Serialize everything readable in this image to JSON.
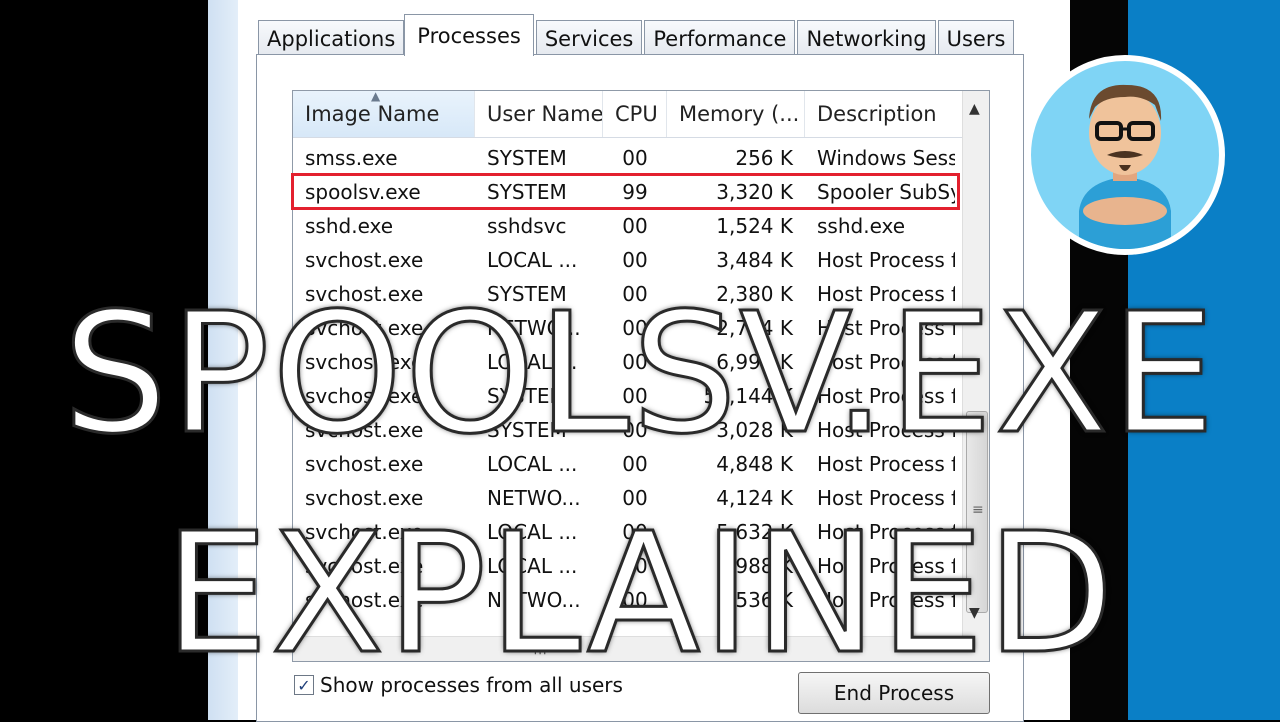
{
  "tabs": [
    "Applications",
    "Processes",
    "Services",
    "Performance",
    "Networking",
    "Users"
  ],
  "active_tab": "Processes",
  "columns": [
    "Image Name",
    "User Name",
    "CPU",
    "Memory (...",
    "Description"
  ],
  "rows": [
    {
      "name": "smss.exe",
      "user": "SYSTEM",
      "cpu": "00",
      "mem": "256 K",
      "desc": "Windows Sess"
    },
    {
      "name": "spoolsv.exe",
      "user": "SYSTEM",
      "cpu": "99",
      "mem": "3,320 K",
      "desc": "Spooler SubSy"
    },
    {
      "name": "sshd.exe",
      "user": "sshdsvc",
      "cpu": "00",
      "mem": "1,524 K",
      "desc": "sshd.exe"
    },
    {
      "name": "svchost.exe",
      "user": "LOCAL ...",
      "cpu": "00",
      "mem": "3,484 K",
      "desc": "Host Process f"
    },
    {
      "name": "svchost.exe",
      "user": "SYSTEM",
      "cpu": "00",
      "mem": "2,380 K",
      "desc": "Host Process f"
    },
    {
      "name": "svchost.exe",
      "user": "NETWO...",
      "cpu": "00",
      "mem": "2,764 K",
      "desc": "Host Process f"
    },
    {
      "name": "svchost.exe",
      "user": "LOCAL ...",
      "cpu": "00",
      "mem": "6,992 K",
      "desc": "Host Process f"
    },
    {
      "name": "svchost.exe",
      "user": "SYSTEM",
      "cpu": "00",
      "mem": "50,144 K",
      "desc": "Host Process f"
    },
    {
      "name": "svchost.exe",
      "user": "SYSTEM",
      "cpu": "00",
      "mem": "3,028 K",
      "desc": "Host Process f"
    },
    {
      "name": "svchost.exe",
      "user": "LOCAL ...",
      "cpu": "00",
      "mem": "4,848 K",
      "desc": "Host Process f"
    },
    {
      "name": "svchost.exe",
      "user": "NETWO...",
      "cpu": "00",
      "mem": "4,124 K",
      "desc": "Host Process f"
    },
    {
      "name": "svchost.exe",
      "user": "LOCAL ...",
      "cpu": "00",
      "mem": "5,632 K",
      "desc": "Host Process f"
    },
    {
      "name": "svchost.exe",
      "user": "LOCAL ...",
      "cpu": "00",
      "mem": "988 K",
      "desc": "Host Process f"
    },
    {
      "name": "svchost.exe",
      "user": "NETWO...",
      "cpu": "00",
      "mem": "1,536 K",
      "desc": "Host Process f"
    }
  ],
  "highlighted_row": 1,
  "checkbox": {
    "label": "Show processes from all users",
    "checked": true
  },
  "end_button": "End Process",
  "overlay": {
    "line1": "SPOOLSV.EXE",
    "line2": "EXPLAINED"
  },
  "colors": {
    "highlight": "#e3202e",
    "brand_blue": "#0a7fc6"
  }
}
